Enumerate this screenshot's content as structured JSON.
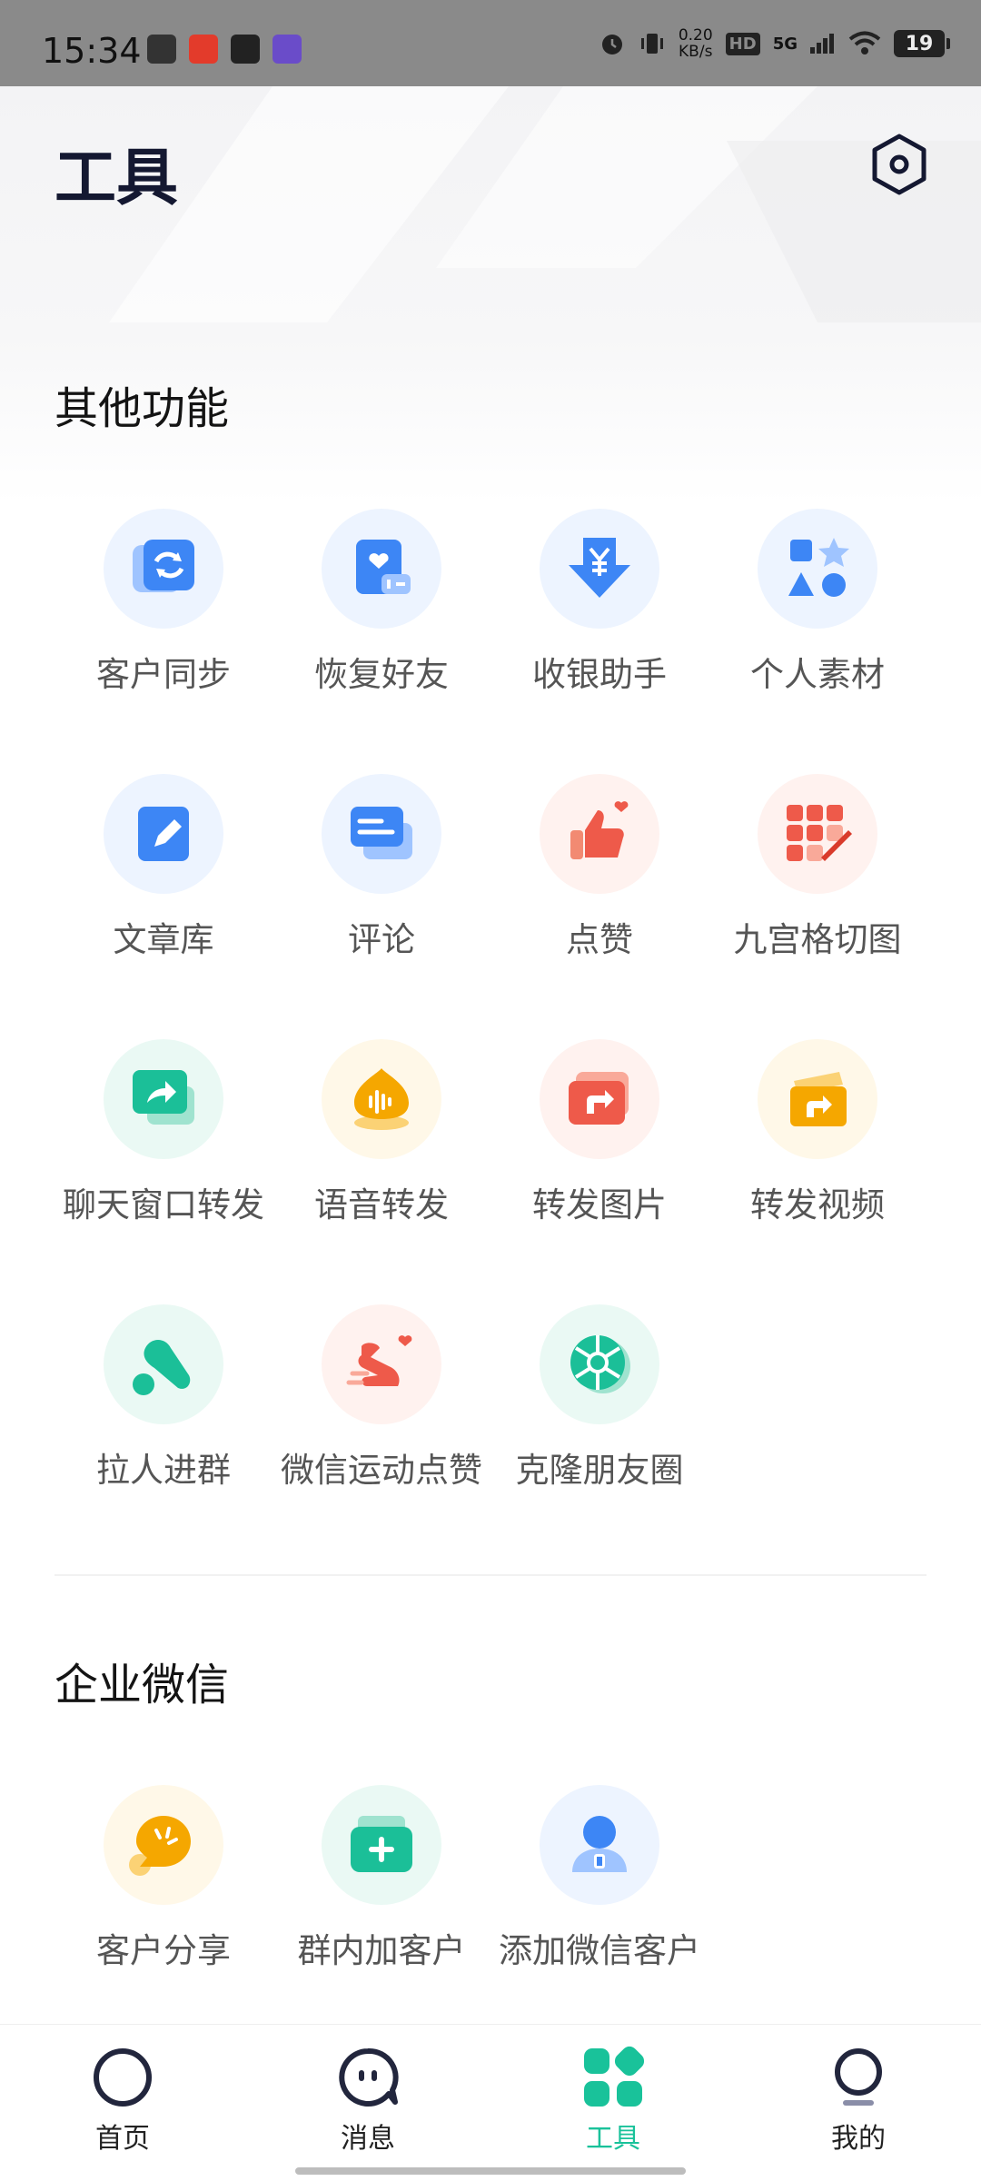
{
  "status_bar": {
    "time": "15:34",
    "net_speed": "0.20",
    "net_unit": "KB/s",
    "hd": "HD",
    "signal": "5G",
    "battery": "19"
  },
  "header": {
    "title": "工具",
    "settings_icon": "hexagon-settings-icon"
  },
  "sections": {
    "other": {
      "title": "其他功能",
      "items": [
        {
          "label": "客户同步",
          "icon": "sync-icon"
        },
        {
          "label": "恢复好友",
          "icon": "restore-friend-icon"
        },
        {
          "label": "收银助手",
          "icon": "cashier-icon"
        },
        {
          "label": "个人素材",
          "icon": "shapes-icon"
        },
        {
          "label": "文章库",
          "icon": "edit-doc-icon"
        },
        {
          "label": "评论",
          "icon": "comment-icon"
        },
        {
          "label": "点赞",
          "icon": "like-icon"
        },
        {
          "label": "九宫格切图",
          "icon": "grid-cut-icon"
        },
        {
          "label": "聊天窗口转发",
          "icon": "chat-forward-icon"
        },
        {
          "label": "语音转发",
          "icon": "voice-forward-icon"
        },
        {
          "label": "转发图片",
          "icon": "image-forward-icon"
        },
        {
          "label": "转发视频",
          "icon": "video-forward-icon"
        },
        {
          "label": "拉人进群",
          "icon": "group-invite-icon"
        },
        {
          "label": "微信运动点赞",
          "icon": "sport-like-icon"
        },
        {
          "label": "克隆朋友圈",
          "icon": "moments-clone-icon"
        }
      ]
    },
    "enterprise": {
      "title": "企业微信",
      "items": [
        {
          "label": "客户分享",
          "icon": "share-icon"
        },
        {
          "label": "群内加客户",
          "icon": "group-add-icon"
        },
        {
          "label": "添加微信客户",
          "icon": "add-contact-icon"
        }
      ]
    }
  },
  "tabbar": {
    "items": [
      {
        "label": "首页",
        "icon": "home-icon"
      },
      {
        "label": "消息",
        "icon": "message-icon"
      },
      {
        "label": "工具",
        "icon": "tools-icon"
      },
      {
        "label": "我的",
        "icon": "profile-icon"
      }
    ],
    "active_index": 2
  },
  "colors": {
    "accent": "#19c29a",
    "title": "#141831",
    "label": "#555555"
  }
}
